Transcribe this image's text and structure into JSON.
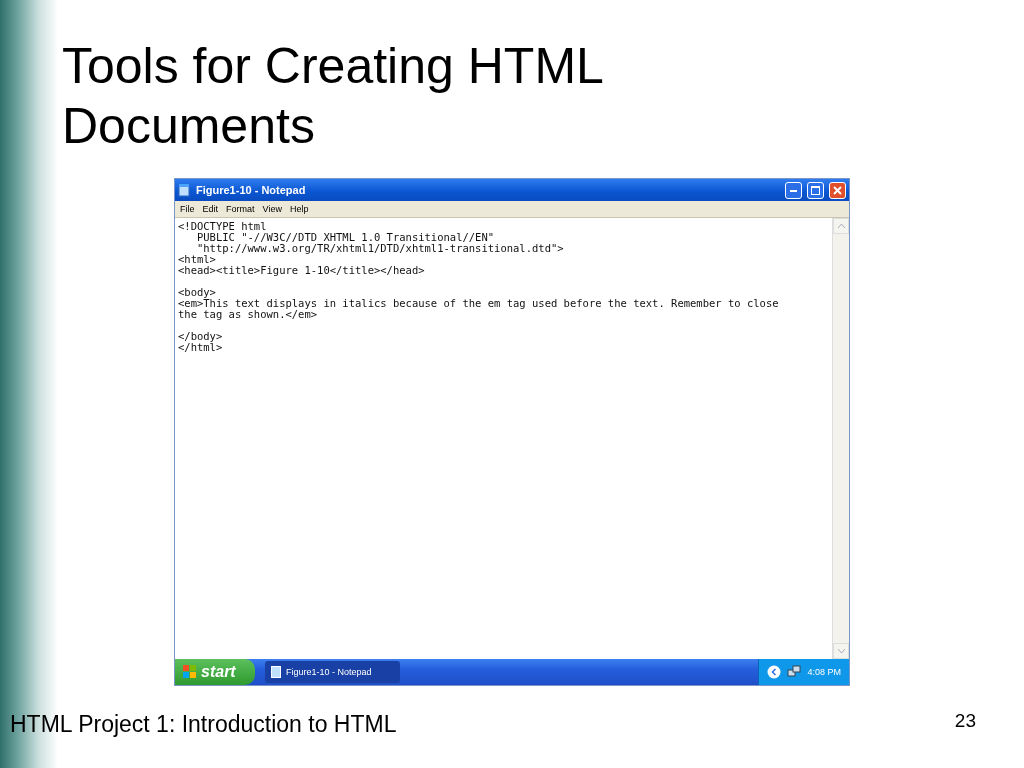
{
  "slide": {
    "title": "Tools for Creating HTML Documents",
    "footer": "HTML Project 1: Introduction to HTML",
    "page_number": "23"
  },
  "window": {
    "title": "Figure1-10 - Notepad",
    "menu": [
      "File",
      "Edit",
      "Format",
      "View",
      "Help"
    ],
    "code_blocks": [
      [
        "<!DOCTYPE html",
        "   PUBLIC \"-//W3C//DTD XHTML 1.0 Transitional//EN\"",
        "   \"http://www.w3.org/TR/xhtml1/DTD/xhtml1-transitional.dtd\">",
        "<html>",
        "<head><title>Figure 1-10</title></head>"
      ],
      [
        "<body>",
        "<em>This text displays in italics because of the em tag used before the text. Remember to close",
        "the tag as shown.</em>"
      ],
      [
        "</body>",
        "</html>"
      ]
    ]
  },
  "taskbar": {
    "start": "start",
    "tasks": [
      {
        "label": "Figure1-10 - Notepad",
        "selected": true
      }
    ],
    "clock": "4:08 PM"
  }
}
